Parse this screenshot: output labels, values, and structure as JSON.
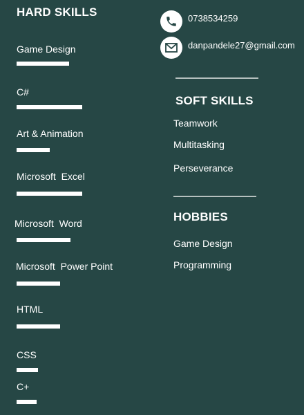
{
  "hard_skills": {
    "title": "HARD SKILLS",
    "items": [
      {
        "label": "Game Design",
        "level": 0.8
      },
      {
        "label": "C#",
        "level": 1.0
      },
      {
        "label": "Art & Animation",
        "level": 0.5
      },
      {
        "label": "Microsoft  Excel",
        "level": 1.0
      },
      {
        "label": "Microsoft  Word",
        "level": 0.82
      },
      {
        "label": "Microsoft  Power Point",
        "level": 0.66
      },
      {
        "label": "HTML",
        "level": 0.66
      },
      {
        "label": "CSS",
        "level": 0.33
      },
      {
        "label": "C+",
        "level": 0.31
      }
    ]
  },
  "contact": {
    "phone": "0738534259",
    "email": "danpandele27@gmail.com",
    "phone_icon": "phone-icon",
    "email_icon": "envelope-icon"
  },
  "soft_skills": {
    "title": "SOFT SKILLS",
    "items": [
      "Teamwork",
      "Multitasking",
      "Perseverance"
    ]
  },
  "hobbies": {
    "title": "HOBBIES",
    "items": [
      "Game Design",
      "Programming"
    ]
  },
  "colors": {
    "background": "#264745",
    "text": "#ffffff",
    "divider": "#b5c0be"
  }
}
